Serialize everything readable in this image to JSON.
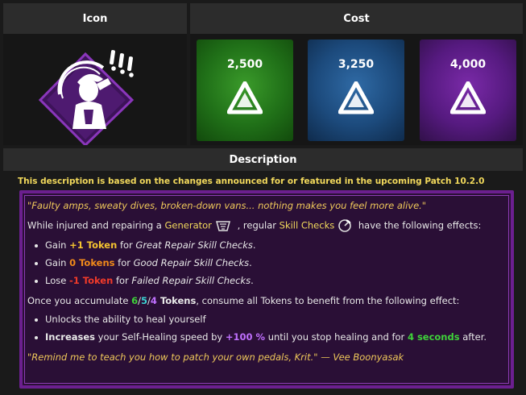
{
  "headers": {
    "icon": "Icon",
    "cost": "Cost",
    "description": "Description"
  },
  "perk_icon": {
    "name": "perk-icon",
    "colors": {
      "diamond": "#4a1a6a",
      "border": "#7a2aa8",
      "figure": "#ffffff"
    }
  },
  "costs": [
    {
      "tier": "green",
      "price": "2,500",
      "color": "#2a8020"
    },
    {
      "tier": "blue",
      "price": "3,250",
      "color": "#245a92"
    },
    {
      "tier": "purple",
      "price": "4,000",
      "color": "#621e8e"
    }
  ],
  "notice": "This description is based on the changes announced for or featured in the upcoming Patch 10.2.0",
  "description": {
    "quote_top": "\"Faulty amps, sweaty dives, broken-down vans... nothing makes you feel more alive.\"",
    "intro": {
      "a": "While injured and repairing a ",
      "generator": "Generator",
      "b": " , regular ",
      "skill_checks": "Skill Checks",
      "c": " have the following effects:"
    },
    "effects": [
      {
        "a": "Gain ",
        "hl": "+1 Token",
        "b": " for ",
        "c": "Great Repair Skill Checks",
        "d": "."
      },
      {
        "a": "Gain ",
        "hl": "0 Tokens",
        "b": " for ",
        "c": "Good Repair Skill Checks",
        "d": "."
      },
      {
        "a": "Lose ",
        "hl": "-1 Token",
        "b": " for ",
        "c": "Failed Repair Skill Checks",
        "d": "."
      }
    ],
    "accumulate": {
      "a": "Once you accumulate ",
      "t1": "6",
      "s1": "/",
      "t2": "5",
      "s2": "/",
      "t3": "4",
      "tokens": " Tokens",
      "b": ", consume all Tokens to benefit from the following effect:"
    },
    "benefits": {
      "one": "Unlocks the ability to heal yourself",
      "two": {
        "a": "Increases",
        "b": " your Self-Healing speed by ",
        "pct": "+100 %",
        "c": " until you stop healing and for ",
        "secs": "4 seconds",
        "d": " after."
      }
    },
    "quote_bottom": "\"Remind me to teach you how to patch your own pedals, Krit.\" — Vee Boonyasak"
  }
}
